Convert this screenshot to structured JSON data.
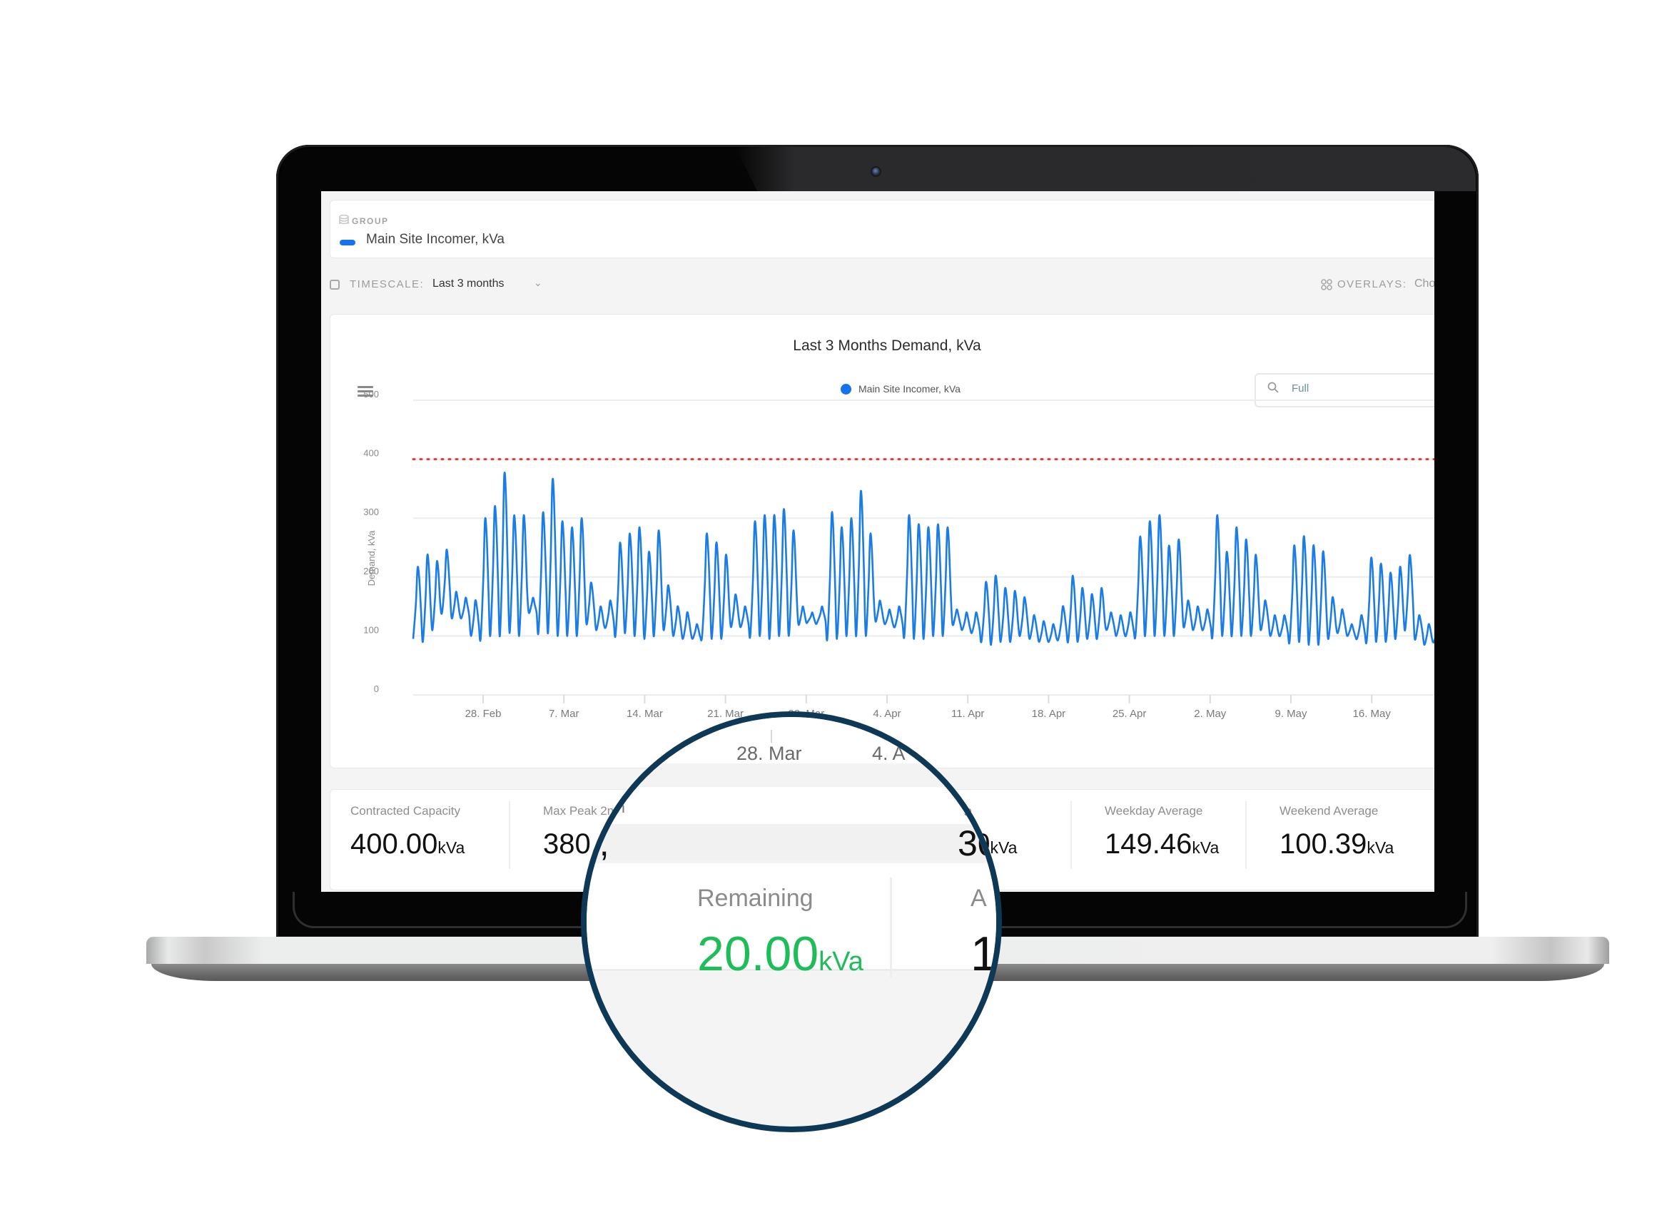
{
  "group": {
    "label": "GROUP",
    "series_name": "Main Site Incomer, kVa",
    "series_color": "#1574ea"
  },
  "toolbar": {
    "timescale_label": "TIMESCALE:",
    "timescale_value": "Last 3 months",
    "overlays_label": "OVERLAYS:",
    "overlays_value": "Cho"
  },
  "chart": {
    "zoom_value": "Full",
    "menu_icon": "hamburger-icon"
  },
  "chart_data": {
    "type": "line",
    "title": "Last 3 Months Demand, kVa",
    "xlabel": "",
    "ylabel": "Demand, kVa",
    "ylim": [
      0,
      500
    ],
    "yticks": [
      "0",
      "100",
      "200",
      "300",
      "400",
      "500"
    ],
    "xticks": [
      "28. Feb",
      "7. Mar",
      "14. Mar",
      "21. Mar",
      "28. Mar",
      "4. Apr",
      "11. Apr",
      "18. Apr",
      "25. Apr",
      "2. May",
      "9. May",
      "16. May"
    ],
    "legend": [
      "Main Site Incomer, kVa"
    ],
    "legend_position": "top-center",
    "grid": true,
    "threshold": {
      "value": 400,
      "color": "#e03a3a",
      "style": "dotted"
    },
    "series": [
      {
        "name": "Main Site Incomer, kVa",
        "color": "#1b7ce6",
        "x_start": "23. Feb",
        "daily_peaks": [
          215,
          235,
          225,
          245,
          175,
          165,
          160,
          295,
          315,
          370,
          300,
          300,
          165,
          305,
          360,
          290,
          280,
          295,
          190,
          150,
          160,
          255,
          270,
          280,
          240,
          275,
          185,
          150,
          140,
          120,
          270,
          255,
          235,
          170,
          150,
          290,
          300,
          300,
          310,
          275,
          150,
          140,
          150,
          305,
          280,
          295,
          340,
          270,
          160,
          145,
          150,
          300,
          285,
          280,
          285,
          280,
          145,
          140,
          140,
          190,
          200,
          180,
          175,
          165,
          135,
          125,
          120,
          150,
          200,
          180,
          170,
          180,
          140,
          135,
          140,
          265,
          290,
          300,
          250,
          260,
          160,
          150,
          145,
          300,
          240,
          280,
          260,
          235,
          160,
          135,
          135,
          250,
          265,
          250,
          240,
          165,
          145,
          120,
          135,
          230,
          220,
          205,
          215,
          235,
          135,
          120,
          130
        ],
        "daily_troughs": [
          95,
          90,
          110,
          140,
          130,
          130,
          100,
          95,
          100,
          100,
          105,
          100,
          140,
          105,
          105,
          100,
          100,
          100,
          120,
          110,
          115,
          100,
          105,
          100,
          95,
          100,
          110,
          100,
          95,
          95,
          100,
          95,
          95,
          115,
          115,
          100,
          100,
          95,
          100,
          100,
          120,
          125,
          125,
          95,
          95,
          100,
          100,
          100,
          125,
          120,
          115,
          100,
          95,
          95,
          100,
          100,
          120,
          110,
          105,
          90,
          85,
          90,
          90,
          100,
          95,
          90,
          90,
          95,
          90,
          90,
          95,
          95,
          110,
          100,
          100,
          100,
          100,
          100,
          100,
          100,
          115,
          110,
          110,
          100,
          100,
          100,
          100,
          100,
          110,
          100,
          100,
          90,
          90,
          85,
          85,
          95,
          105,
          100,
          95,
          90,
          90,
          90,
          95,
          110,
          95,
          85,
          90
        ]
      }
    ]
  },
  "stats": [
    {
      "label": "Contracted Capacity",
      "value": "400.00",
      "unit": "kVa",
      "color": "#111111"
    },
    {
      "label": "Max Peak 2n",
      "value": "380.",
      "unit": "",
      "color": "#111111"
    },
    {
      "label": "ge",
      "value": "30",
      "unit": "kVa",
      "color": "#111111"
    },
    {
      "label": "Weekday Average",
      "value": "149.46",
      "unit": "kVa",
      "color": "#111111"
    },
    {
      "label": "Weekend Average",
      "value": "100.39",
      "unit": "kVa",
      "color": "#111111"
    }
  ],
  "magnifier": {
    "dates": [
      "28. Mar",
      "4. A"
    ],
    "top_labels": [
      "ak 2n",
      "ge"
    ],
    "top_values": [
      "0,",
      "30"
    ],
    "remaining_label": "Remaining",
    "remaining_value": "20.00",
    "remaining_unit": "kVa",
    "remaining_color": "#1fbc5a",
    "next_label": "A",
    "next_value": "1",
    "border_color": "#0e3956"
  }
}
